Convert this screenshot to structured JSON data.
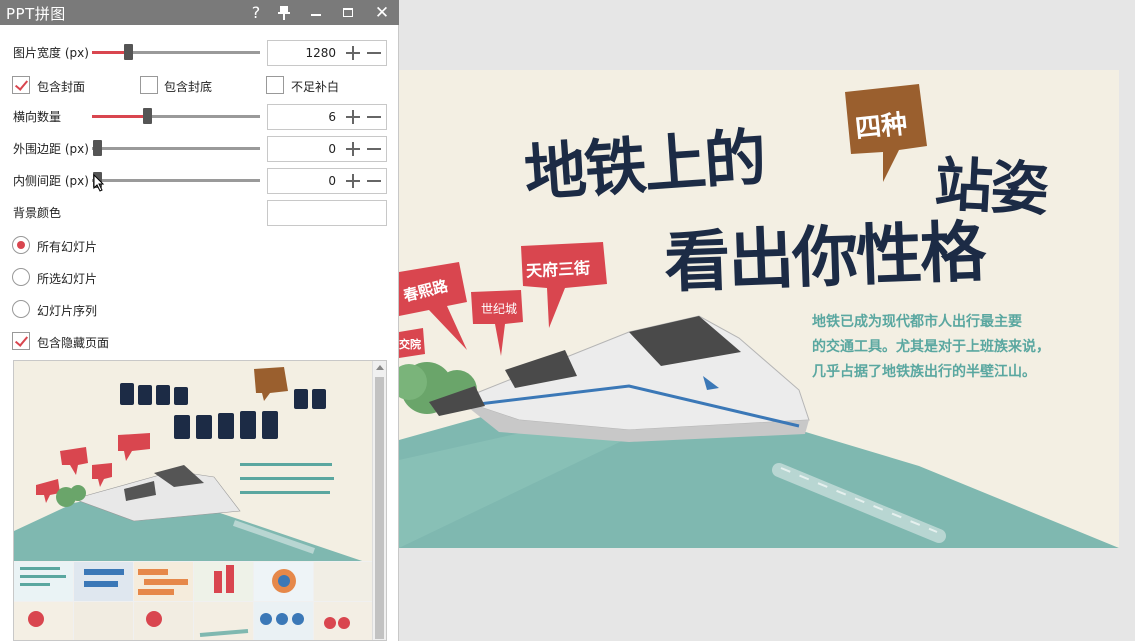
{
  "window": {
    "title": "PPT拼图"
  },
  "titlebar_icons": [
    "help-icon",
    "pin-icon",
    "minimize-icon",
    "maximize-icon",
    "close-icon"
  ],
  "settings": {
    "image_width": {
      "label": "图片宽度 (px)",
      "value": "1280"
    },
    "checkbox_row_1": [
      {
        "label": "包含封面",
        "checked": true
      },
      {
        "label": "包含封底",
        "checked": false
      },
      {
        "label": "不足补白",
        "checked": false
      }
    ],
    "columns": {
      "label": "横向数量",
      "value": "6"
    },
    "outer_margin": {
      "label": "外围边距 (px)",
      "value": "0"
    },
    "inner_spacing": {
      "label": "内侧间距 (px)",
      "value": "0"
    },
    "bg_color": {
      "label": "背景颜色",
      "value": ""
    },
    "slide_scope": [
      {
        "label": "所有幻灯片",
        "selected": true
      },
      {
        "label": "所选幻灯片",
        "selected": false
      },
      {
        "label": "幻灯片序列",
        "selected": false
      }
    ],
    "include_hidden": {
      "label": "包含隐藏页面",
      "checked": true
    }
  },
  "slide": {
    "title_line_1": "地铁上的",
    "badge": "四种",
    "title_line_1_end": "站姿",
    "title_line_2": "看出你性格",
    "body": [
      "地铁已成为现代都市人出行最主要",
      "的交通工具。尤其是对于上班族来说，",
      "几乎占据了地铁族出行的半壁江山。"
    ],
    "tags": [
      "天府三街",
      "春熙路",
      "世纪城",
      "交院"
    ]
  },
  "colors": {
    "accent": "#d9464f",
    "title_navy": "#1c2b45",
    "badge_brown": "#9a5f2e",
    "teal": "#7fb8b0",
    "slide_bg": "#f3efe3",
    "body_text": "#5aa7a0"
  }
}
